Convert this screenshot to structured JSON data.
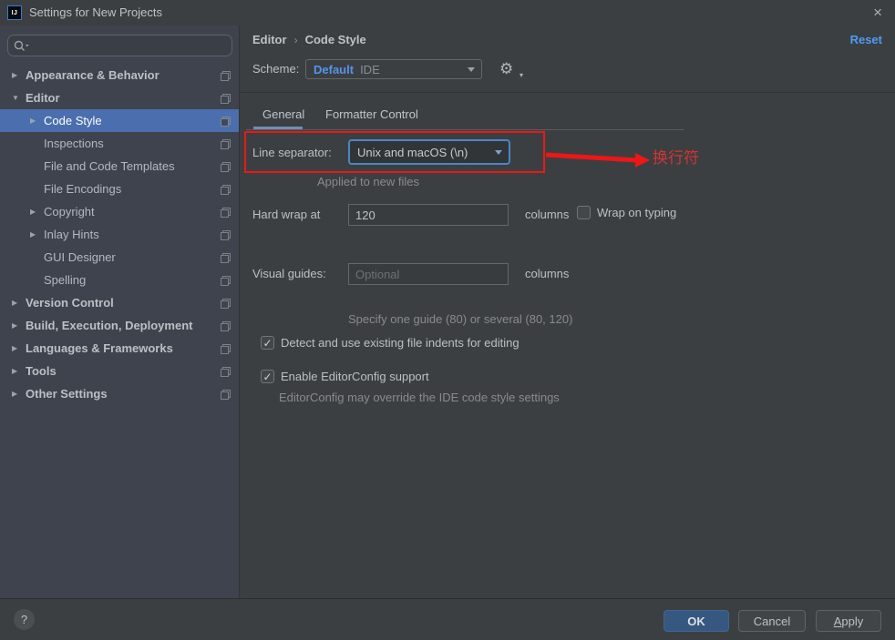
{
  "window": {
    "title": "Settings for New Projects",
    "app_icon_text": "IJ",
    "close_glyph": "×"
  },
  "sidebar": {
    "search_placeholder": "",
    "items": [
      {
        "slug": "appearance-behavior",
        "label": "Appearance & Behavior",
        "level": 0,
        "bold": true,
        "arrow": "collapsed"
      },
      {
        "slug": "editor",
        "label": "Editor",
        "level": 0,
        "bold": true,
        "arrow": "expanded"
      },
      {
        "slug": "code-style",
        "label": "Code Style",
        "level": 1,
        "arrow": "collapsed",
        "selected": true
      },
      {
        "slug": "inspections",
        "label": "Inspections",
        "level": 1
      },
      {
        "slug": "file-and-code-templates",
        "label": "File and Code Templates",
        "level": 1
      },
      {
        "slug": "file-encodings",
        "label": "File Encodings",
        "level": 1
      },
      {
        "slug": "copyright",
        "label": "Copyright",
        "level": 1,
        "arrow": "collapsed"
      },
      {
        "slug": "inlay-hints",
        "label": "Inlay Hints",
        "level": 1,
        "arrow": "collapsed"
      },
      {
        "slug": "gui-designer",
        "label": "GUI Designer",
        "level": 1
      },
      {
        "slug": "spelling",
        "label": "Spelling",
        "level": 1
      },
      {
        "slug": "version-control",
        "label": "Version Control",
        "level": 0,
        "bold": true,
        "arrow": "collapsed"
      },
      {
        "slug": "build-execution-deployment",
        "label": "Build, Execution, Deployment",
        "level": 0,
        "bold": true,
        "arrow": "collapsed"
      },
      {
        "slug": "languages-frameworks",
        "label": "Languages & Frameworks",
        "level": 0,
        "bold": true,
        "arrow": "collapsed"
      },
      {
        "slug": "tools",
        "label": "Tools",
        "level": 0,
        "bold": true,
        "arrow": "collapsed"
      },
      {
        "slug": "other-settings",
        "label": "Other Settings",
        "level": 0,
        "bold": true,
        "arrow": "collapsed"
      }
    ]
  },
  "header": {
    "breadcrumb_parent": "Editor",
    "breadcrumb_separator": "›",
    "breadcrumb_current": "Code Style",
    "reset_label": "Reset"
  },
  "scheme": {
    "label": "Scheme:",
    "value": "Default",
    "value_suffix": "IDE"
  },
  "tabs": {
    "general": "General",
    "formatter_control": "Formatter Control"
  },
  "form": {
    "line_separator": {
      "label": "Line separator:",
      "value": "Unix and macOS (\\n)",
      "hint": "Applied to new files"
    },
    "hard_wrap": {
      "label": "Hard wrap at",
      "value": "120",
      "suffix": "columns",
      "wrap_on_typing_label": "Wrap on typing",
      "wrap_on_typing_checked": false
    },
    "visual_guides": {
      "label": "Visual guides:",
      "placeholder": "Optional",
      "suffix": "columns",
      "hint": "Specify one guide (80) or several (80, 120)"
    },
    "detect_indents": {
      "label": "Detect and use existing file indents for editing",
      "checked": true,
      "checkmark": "✓"
    },
    "editorconfig": {
      "label": "Enable EditorConfig support",
      "checked": true,
      "checkmark": "✓",
      "hint": "EditorConfig may override the IDE code style settings"
    }
  },
  "annotation": {
    "text": "换行符"
  },
  "footer": {
    "help_glyph": "?",
    "ok_label": "OK",
    "cancel_label": "Cancel",
    "apply_label": "Apply"
  },
  "colors": {
    "selection_blue": "#4b6eaf",
    "link_blue": "#4e9bf5",
    "scheme_value_blue": "#5394ec",
    "focus_border_blue": "#4a86c6",
    "ok_button_blue": "#365880",
    "annotation_red": "#ee1616",
    "panel_bg": "#3c3f41",
    "sidebar_bg": "#3f434e"
  }
}
